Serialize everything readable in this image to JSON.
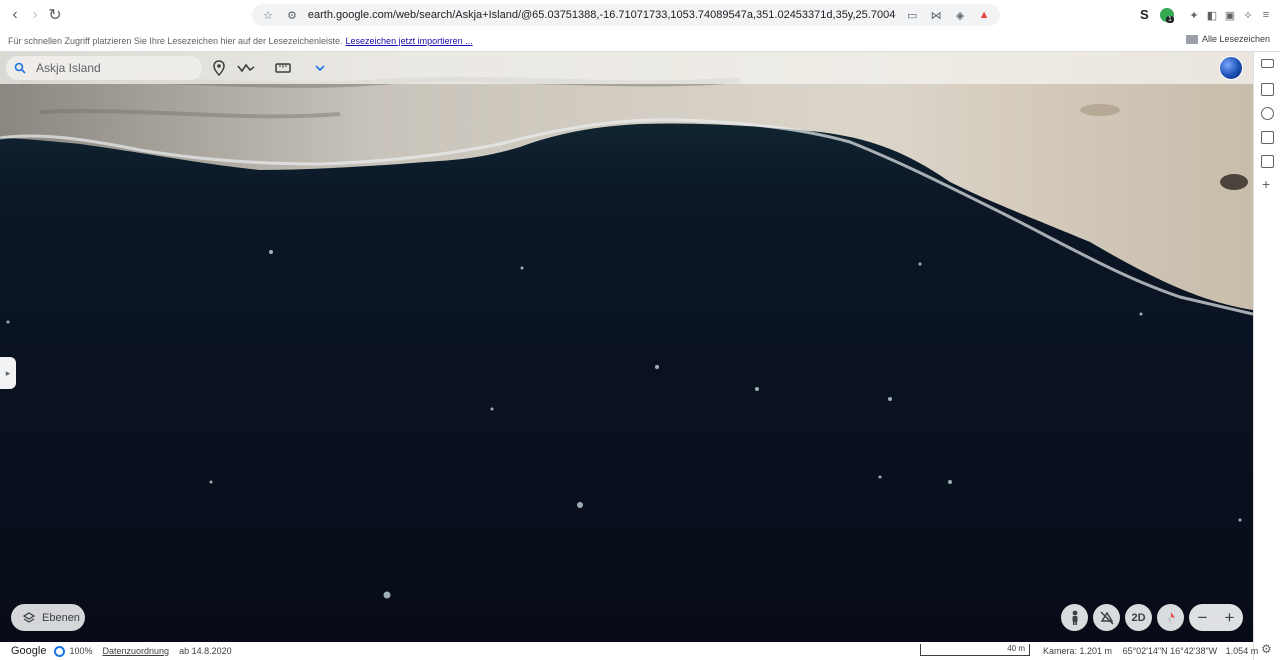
{
  "browser": {
    "url": "earth.google.com/web/search/Askja+Island/@65.03751388,-16.71071733,1053.74089547a,351.02453371d,35y,25.70046394h,65.2481626...",
    "extension_badge": "1"
  },
  "bookmarks_bar": {
    "message": "Für schnellen Zugriff platzieren Sie Ihre Lesezeichen hier auf der Lesezeichenleiste.",
    "import_link": "Lesezeichen jetzt importieren ...",
    "all_bookmarks": "Alle Lesezeichen"
  },
  "earth_toolbar": {
    "search_value": "Askja Island"
  },
  "map_controls": {
    "layers_label": "Ebenen",
    "mode_2d_label": "2D",
    "zoom_out_label": "−",
    "zoom_in_label": "+"
  },
  "status_bar": {
    "brand": "Google",
    "progress": "100%",
    "attribution": "Datenzuordnung",
    "imagery_date": "ab 14.8.2020",
    "scale_label": "40 m",
    "camera": "Kamera: 1.201 m",
    "coordinates": "65°02'14\"N 16°42'38\"W",
    "elevation": "1.054 m"
  },
  "colors": {
    "water": "#0a0f1a",
    "shore": "#d9d3c9",
    "accent": "#1a73e8"
  }
}
